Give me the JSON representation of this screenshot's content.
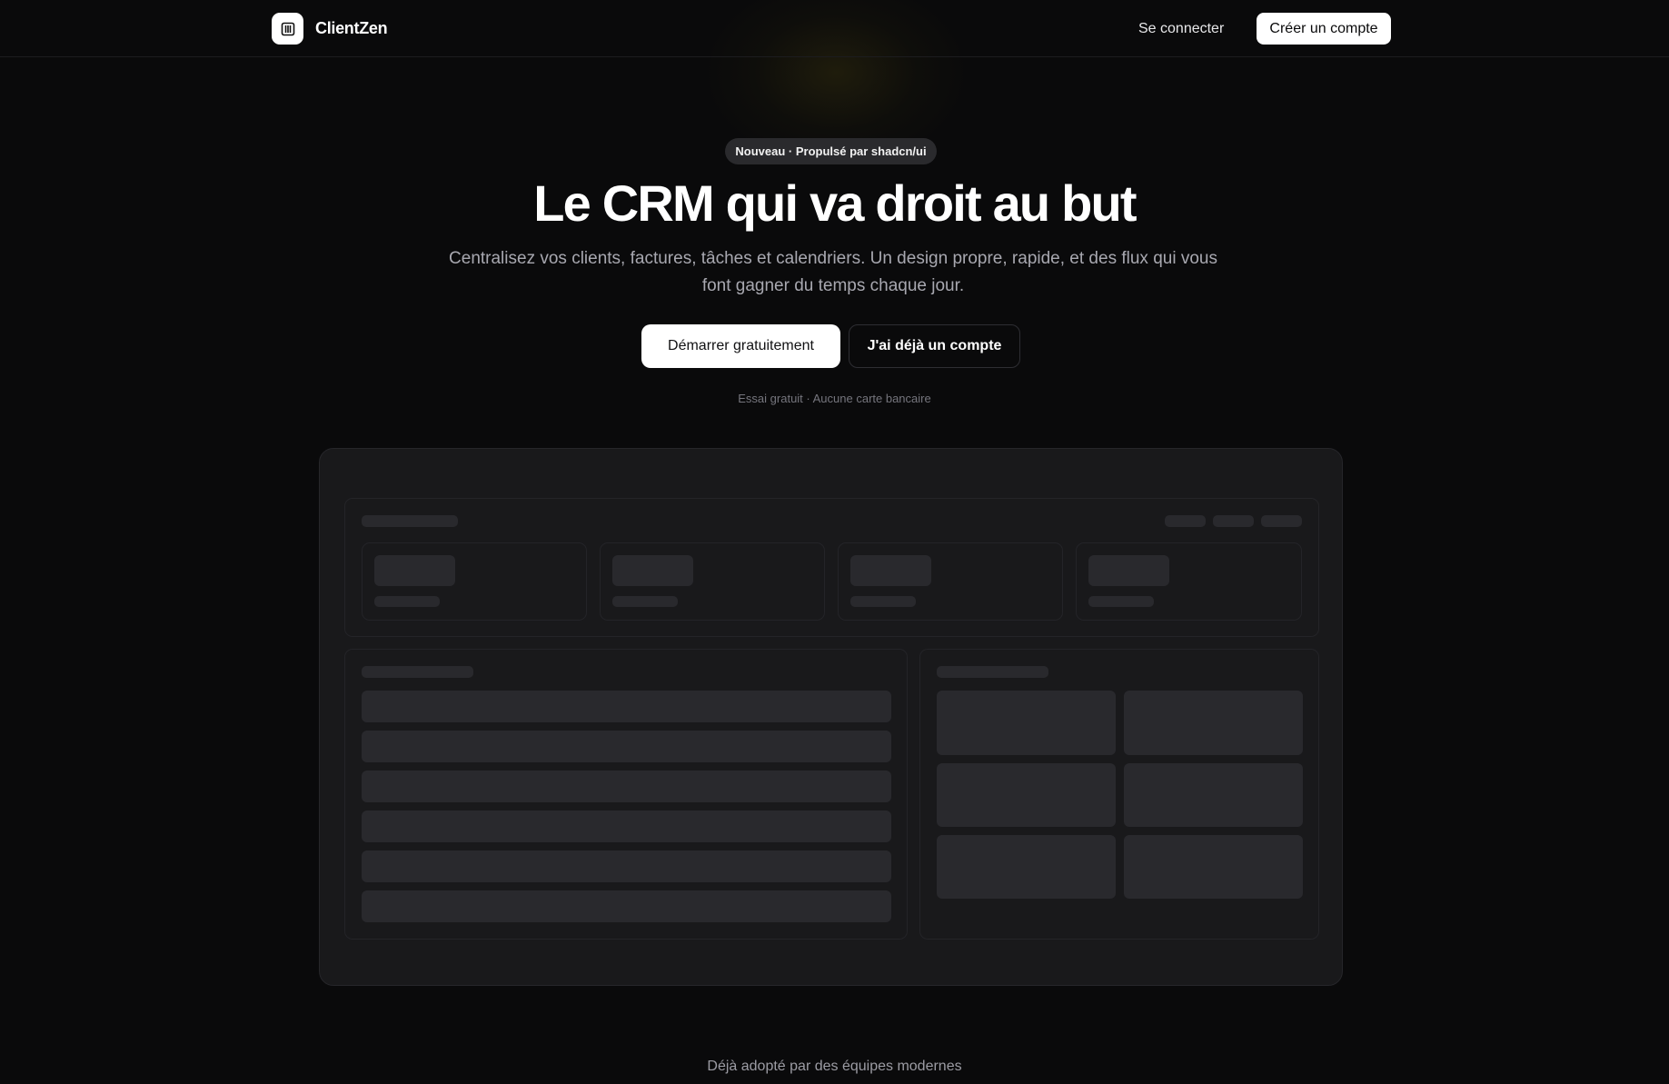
{
  "header": {
    "brand_name": "ClientZen",
    "logo_icon": "columns-icon",
    "login_label": "Se connecter",
    "signup_label": "Créer un compte"
  },
  "hero": {
    "badge": "Nouveau · Propulsé par shadcn/ui",
    "title": "Le CRM qui va droit au but",
    "subtitle": "Centralisez vos clients, factures, tâches et calendriers. Un design propre, rapide, et des flux qui vous font gagner du temps chaque jour.",
    "primary_cta": "Démarrer gratuitement",
    "secondary_cta": "J'ai déjà un compte",
    "note": "Essai gratuit · Aucune carte bancaire"
  },
  "preview": {
    "stat_cards": 4,
    "list_rows": 6,
    "grid_tiles": 6
  },
  "footer": {
    "trusted_text": "Déjà adopté par des équipes modernes"
  },
  "colors": {
    "background": "#0a0a0b",
    "surface": "#19191b",
    "skeleton": "#29292d",
    "primary_button": "#ffffff"
  }
}
